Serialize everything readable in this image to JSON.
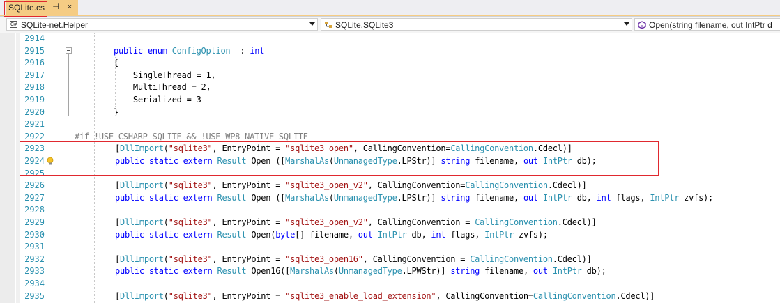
{
  "tab": {
    "filename": "SQLite.cs",
    "pin_glyph": "⊣",
    "close_glyph": "×"
  },
  "navbar": {
    "project": "SQLite-net.Helper",
    "type": "SQLite.SQLite3",
    "member": "Open(string filename, out IntPtr d"
  },
  "lines": [
    {
      "n": "2914",
      "tokens": []
    },
    {
      "n": "2915",
      "tokens": [
        [
          "kw",
          "public "
        ],
        [
          "kw",
          "enum "
        ],
        [
          "ty",
          "ConfigOption"
        ],
        [
          "",
          "  : "
        ],
        [
          "kw",
          "int"
        ]
      ]
    },
    {
      "n": "2916",
      "tokens": [
        [
          "",
          "{"
        ]
      ]
    },
    {
      "n": "2917",
      "tokens": [
        [
          "",
          "    SingleThread = 1,"
        ]
      ]
    },
    {
      "n": "2918",
      "tokens": [
        [
          "",
          "    MultiThread = 2,"
        ]
      ]
    },
    {
      "n": "2919",
      "tokens": [
        [
          "",
          "    Serialized = 3"
        ]
      ]
    },
    {
      "n": "2920",
      "tokens": [
        [
          "",
          "}"
        ]
      ]
    },
    {
      "n": "2921",
      "tokens": []
    },
    {
      "n": "2922",
      "tokens": [
        [
          "pp",
          "#if !USE_CSHARP_SQLITE && !USE_WP8_NATIVE_SQLITE"
        ]
      ]
    },
    {
      "n": "2923",
      "tokens": [
        [
          "",
          "["
        ],
        [
          "ty",
          "DllImport"
        ],
        [
          "",
          "("
        ],
        [
          "st",
          "\"sqlite3\""
        ],
        [
          "",
          ", EntryPoint = "
        ],
        [
          "st",
          "\"sqlite3_open\""
        ],
        [
          "",
          ", CallingConvention="
        ],
        [
          "ty",
          "CallingConvention"
        ],
        [
          "",
          ".Cdecl)]"
        ]
      ]
    },
    {
      "n": "2924",
      "tokens": [
        [
          "kw",
          "public "
        ],
        [
          "kw",
          "static "
        ],
        [
          "kw",
          "extern "
        ],
        [
          "ty",
          "Result"
        ],
        [
          "",
          " Open (["
        ],
        [
          "ty",
          "MarshalAs"
        ],
        [
          "",
          "("
        ],
        [
          "ty",
          "UnmanagedType"
        ],
        [
          "",
          ".LPStr)] "
        ],
        [
          "kw",
          "string"
        ],
        [
          "",
          " filename, "
        ],
        [
          "kw",
          "out "
        ],
        [
          "ty",
          "IntPtr"
        ],
        [
          "",
          " db);"
        ]
      ]
    },
    {
      "n": "2925",
      "tokens": []
    },
    {
      "n": "2926",
      "tokens": [
        [
          "",
          "["
        ],
        [
          "ty",
          "DllImport"
        ],
        [
          "",
          "("
        ],
        [
          "st",
          "\"sqlite3\""
        ],
        [
          "",
          ", EntryPoint = "
        ],
        [
          "st",
          "\"sqlite3_open_v2\""
        ],
        [
          "",
          ", CallingConvention="
        ],
        [
          "ty",
          "CallingConvention"
        ],
        [
          "",
          ".Cdecl)]"
        ]
      ]
    },
    {
      "n": "2927",
      "tokens": [
        [
          "kw",
          "public "
        ],
        [
          "kw",
          "static "
        ],
        [
          "kw",
          "extern "
        ],
        [
          "ty",
          "Result"
        ],
        [
          "",
          " Open (["
        ],
        [
          "ty",
          "MarshalAs"
        ],
        [
          "",
          "("
        ],
        [
          "ty",
          "UnmanagedType"
        ],
        [
          "",
          ".LPStr)] "
        ],
        [
          "kw",
          "string"
        ],
        [
          "",
          " filename, "
        ],
        [
          "kw",
          "out "
        ],
        [
          "ty",
          "IntPtr"
        ],
        [
          "",
          " db, "
        ],
        [
          "kw",
          "int"
        ],
        [
          "",
          " flags, "
        ],
        [
          "ty",
          "IntPtr"
        ],
        [
          "",
          " zvfs);"
        ]
      ]
    },
    {
      "n": "2928",
      "tokens": []
    },
    {
      "n": "2929",
      "tokens": [
        [
          "",
          "["
        ],
        [
          "ty",
          "DllImport"
        ],
        [
          "",
          "("
        ],
        [
          "st",
          "\"sqlite3\""
        ],
        [
          "",
          ", EntryPoint = "
        ],
        [
          "st",
          "\"sqlite3_open_v2\""
        ],
        [
          "",
          ", CallingConvention = "
        ],
        [
          "ty",
          "CallingConvention"
        ],
        [
          "",
          ".Cdecl)]"
        ]
      ]
    },
    {
      "n": "2930",
      "tokens": [
        [
          "kw",
          "public "
        ],
        [
          "kw",
          "static "
        ],
        [
          "kw",
          "extern "
        ],
        [
          "ty",
          "Result"
        ],
        [
          "",
          " Open("
        ],
        [
          "kw",
          "byte"
        ],
        [
          "",
          "[] filename, "
        ],
        [
          "kw",
          "out "
        ],
        [
          "ty",
          "IntPtr"
        ],
        [
          "",
          " db, "
        ],
        [
          "kw",
          "int"
        ],
        [
          "",
          " flags, "
        ],
        [
          "ty",
          "IntPtr"
        ],
        [
          "",
          " zvfs);"
        ]
      ]
    },
    {
      "n": "2931",
      "tokens": []
    },
    {
      "n": "2932",
      "tokens": [
        [
          "",
          "["
        ],
        [
          "ty",
          "DllImport"
        ],
        [
          "",
          "("
        ],
        [
          "st",
          "\"sqlite3\""
        ],
        [
          "",
          ", EntryPoint = "
        ],
        [
          "st",
          "\"sqlite3_open16\""
        ],
        [
          "",
          ", CallingConvention = "
        ],
        [
          "ty",
          "CallingConvention"
        ],
        [
          "",
          ".Cdecl)]"
        ]
      ]
    },
    {
      "n": "2933",
      "tokens": [
        [
          "kw",
          "public "
        ],
        [
          "kw",
          "static "
        ],
        [
          "kw",
          "extern "
        ],
        [
          "ty",
          "Result"
        ],
        [
          "",
          " Open16(["
        ],
        [
          "ty",
          "MarshalAs"
        ],
        [
          "",
          "("
        ],
        [
          "ty",
          "UnmanagedType"
        ],
        [
          "",
          ".LPWStr)] "
        ],
        [
          "kw",
          "string"
        ],
        [
          "",
          " filename, "
        ],
        [
          "kw",
          "out "
        ],
        [
          "ty",
          "IntPtr"
        ],
        [
          "",
          " db);"
        ]
      ]
    },
    {
      "n": "2934",
      "tokens": []
    },
    {
      "n": "2935",
      "tokens": [
        [
          "",
          "["
        ],
        [
          "ty",
          "DllImport"
        ],
        [
          "",
          "("
        ],
        [
          "st",
          "\"sqlite3\""
        ],
        [
          "",
          ", EntryPoint = "
        ],
        [
          "st",
          "\"sqlite3_enable_load_extension\""
        ],
        [
          "",
          ", CallingConvention="
        ],
        [
          "ty",
          "CallingConvention"
        ],
        [
          "",
          ".Cdecl)]"
        ]
      ]
    }
  ]
}
